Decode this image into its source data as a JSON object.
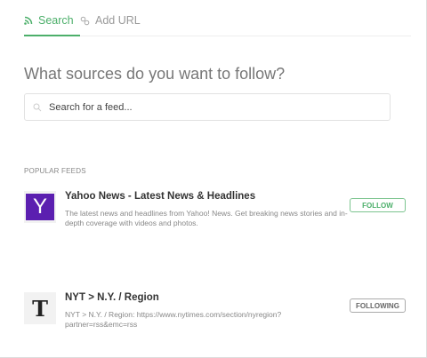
{
  "tabs": [
    {
      "label": "Search",
      "icon": "rss-icon",
      "active": true
    },
    {
      "label": "Add URL",
      "icon": "link-icon",
      "active": false
    }
  ],
  "heading": "What sources do you want to follow?",
  "search": {
    "placeholder": "Search for a feed...",
    "value": ""
  },
  "section_label": "POPULAR FEEDS",
  "feeds": [
    {
      "title": "Yahoo News - Latest News & Headlines",
      "description": "The latest news and headlines from Yahoo! News. Get breaking news stories and in-depth coverage with videos and photos.",
      "button": "FOLLOW",
      "logo": "Y"
    },
    {
      "title": "NYT > N.Y. / Region",
      "description": "NYT > N.Y. / Region: https://www.nytimes.com/section/nyregion?partner=rss&emc=rss",
      "button": "FOLLOWING",
      "logo": "T"
    }
  ],
  "colors": {
    "accent": "#4caf6a",
    "yahoo": "#5b1fb0"
  }
}
